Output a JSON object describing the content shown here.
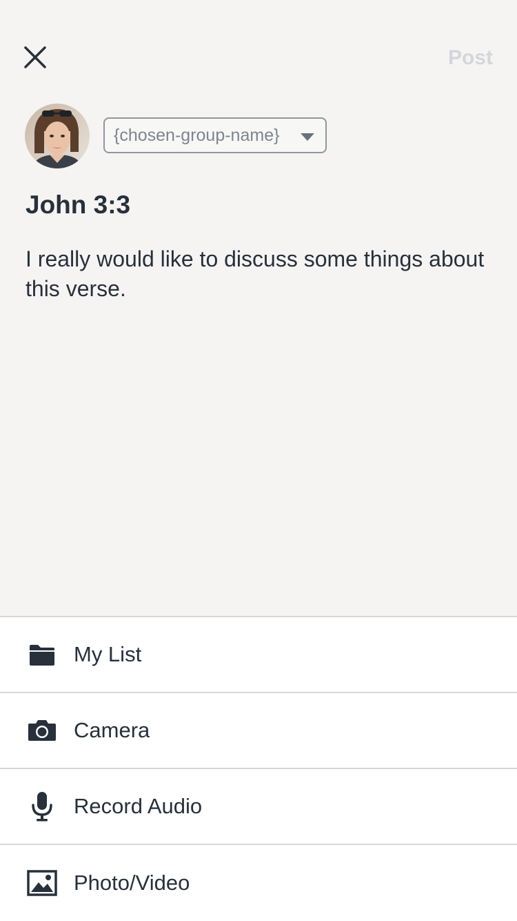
{
  "header": {
    "close_icon": "close-icon",
    "post_label": "Post"
  },
  "composer": {
    "group_select_label": "{chosen-group-name}",
    "verse_reference": "John 3:3",
    "body_text": "I really would like to discuss some things about this verse."
  },
  "actions": [
    {
      "label": "My List",
      "icon": "folder-icon"
    },
    {
      "label": "Camera",
      "icon": "camera-icon"
    },
    {
      "label": "Record Audio",
      "icon": "microphone-icon"
    },
    {
      "label": "Photo/Video",
      "icon": "image-icon"
    }
  ],
  "colors": {
    "compose_bg": "#f5f4f3",
    "text": "#27303b",
    "post_disabled": "#d3d6da",
    "divider": "#d5d8db"
  }
}
